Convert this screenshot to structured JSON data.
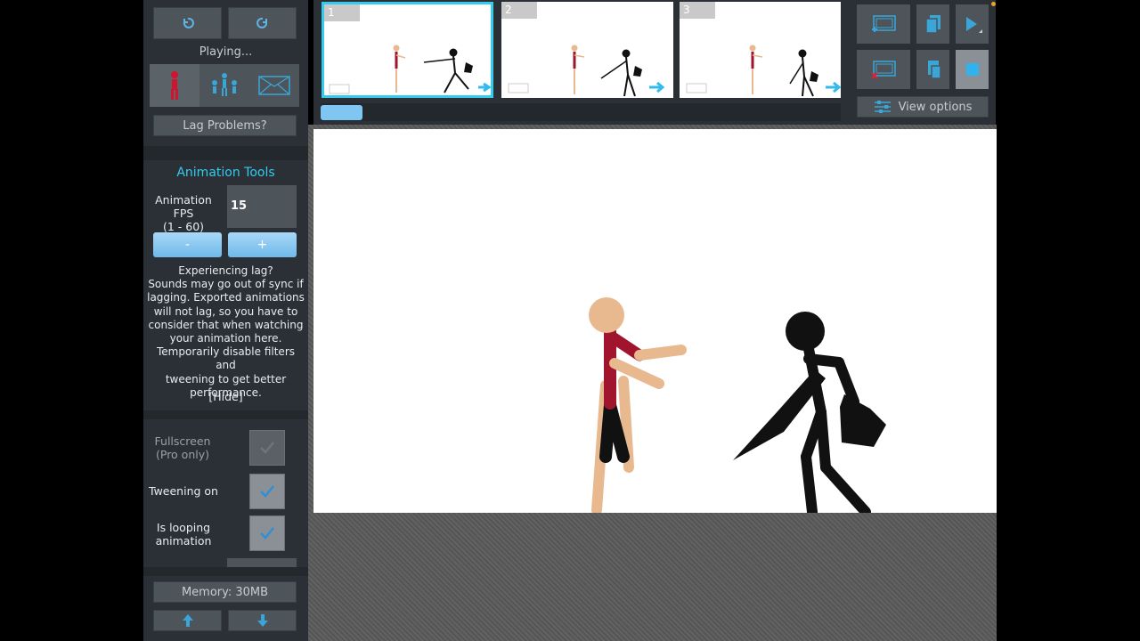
{
  "left_panel": {
    "status": "Playing...",
    "lag_button": "Lag Problems?",
    "tools_title": "Animation Tools",
    "fps_label": "Animation FPS",
    "fps_range": "(1 - 60)",
    "fps_value": "15",
    "minus_label": "-",
    "plus_label": "+",
    "lag_info": [
      "Experiencing lag?",
      "Sounds may go out of sync if",
      "lagging. Exported animations",
      "will not lag, so you have to",
      "consider that when watching",
      "your animation here.",
      "Temporarily disable filters and",
      "tweening to get better",
      "performance."
    ],
    "hide_link": "[Hide]",
    "fullscreen_label": [
      "Fullscreen",
      "(Pro only)"
    ],
    "tweening_label": "Tweening on",
    "looping_label": [
      "Is looping",
      "animation"
    ],
    "memory": "Memory: 30MB"
  },
  "timeline": {
    "frames": [
      {
        "number": "1",
        "selected": true
      },
      {
        "number": "2",
        "selected": false
      },
      {
        "number": "3",
        "selected": false
      }
    ]
  },
  "right_panel": {
    "view_options_label": "View options"
  },
  "colors": {
    "panel": "#2a3035",
    "accent": "#33ccee",
    "button": "#4d545a",
    "figure_red": "#a0142d",
    "skin": "#e8b98f"
  }
}
